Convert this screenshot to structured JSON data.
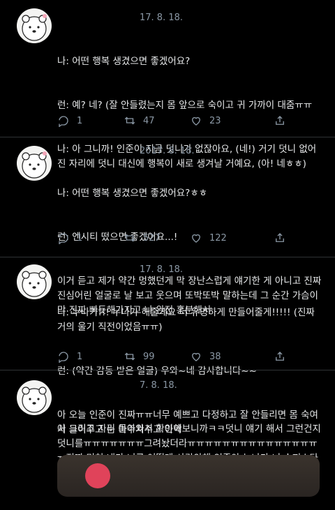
{
  "tweets": [
    {
      "date": "17. 8. 18.",
      "lines": [
        "나: 어떤 행복 생겼으면 좋겠어요?",
        "런: 예? 네? (잘 안들렸는지 몸 앞으로 숙이고 귀 가까이 대줌ㅠㅠ",
        "나: 아 그니까! 인준이 지금 덧니가 없잖아요, (네!) 거기 덧니 없어진 자리에 덧니 대신에 행복이 새로 생겨날 거예요, (아! 네ㅎㅎ)"
      ],
      "replies": "1",
      "retweets": "47",
      "likes": "23"
    },
    {
      "date": "2017. 8. 18.",
      "lines": [
        "나: 어떤 행복 생겼으면 좋겠어요?ㅎㅎ",
        "런: 엔시티 떴으면 좋겠어요...!",
        "이거 듣고 제가 약간 멍했던게 막 장난스럽게 얘기한 게 아니고 진짜 진심어린 얼굴로 날 보고 웃으며 또박또박 말하는데 그 순간 가슴이 막 진짜 빠듯해가지고 나 완전 흥분해서"
      ],
      "replies": "1",
      "retweets": "527",
      "likes": "122"
    },
    {
      "date": "17. 8. 18.",
      "lines": [
        "나: 누나가!!! 누나가 해줄게요 더 유명하게 만들어줄게!!!!! (진짜 거의 울기 직전이었음ㅠㅠ)",
        "런: (약간 감동 받은 얼굴) 우와~네 감사합니다~~",
        "아 오늘 인준이 진짜ㅠㅠ너무 예쁘고 다정하고 잘 안들리면 몸 숙여서 들어주고 눈 마주쳐주고 아악"
      ],
      "replies": "1",
      "retweets": "99",
      "likes": "38"
    },
    {
      "date": "7. 8. 18.",
      "lines": [
        "아 그리고 자리 돌아와서 확인해보니까ㅋㅋ덧니 얘기 해서 그런건지 덧니를ㅠㅠㅠㅠㅠㅠㅠ그려놨더라ㅠㅠㅠㅠㅠㅠㅠㅠㅠㅠㅠㅠㅠㅠㅠㅠ진짜 미쳐 내가 너를 어떻게 사랑안해 인준아 누나가 너 슈퍼스타 만들어줄게ㅠㅠㅠㅠㅠㅠㅠ"
      ]
    }
  ],
  "colors": {
    "background": "#000000",
    "text": "#e7e9ea",
    "muted": "#8b98a5",
    "divider": "#2f3336"
  }
}
